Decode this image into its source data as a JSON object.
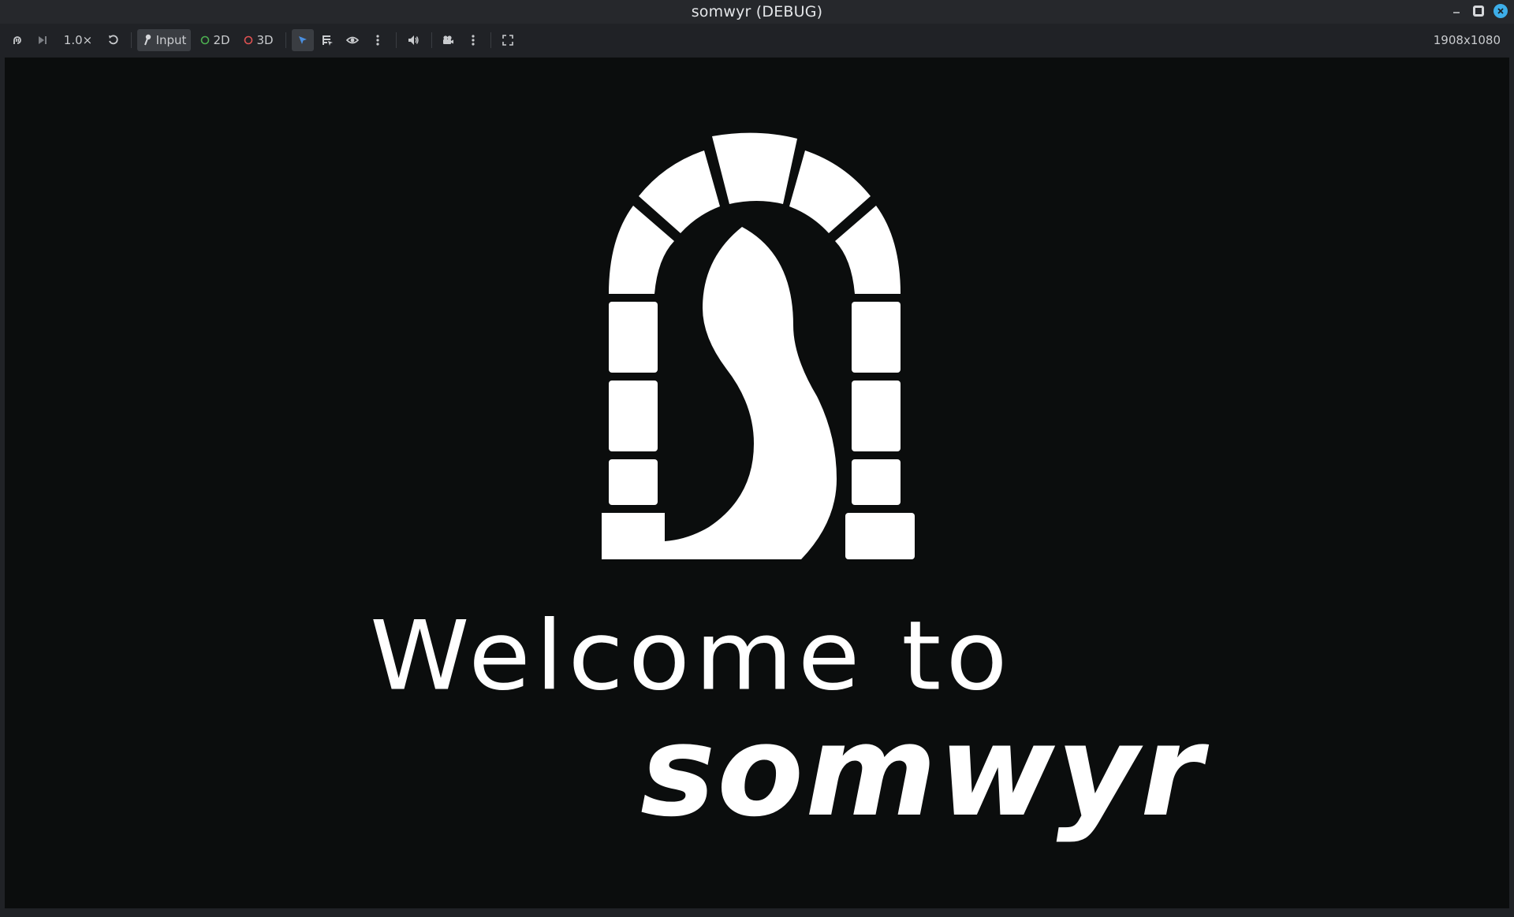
{
  "window": {
    "title": "somwyr (DEBUG)",
    "controls": [
      {
        "name": "minimize-icon"
      },
      {
        "name": "maximize-icon"
      },
      {
        "name": "close-icon"
      }
    ]
  },
  "toolbar": {
    "speed": "1.0×",
    "input_label": "Input",
    "mode_2d_label": "2D",
    "mode_3d_label": "3D",
    "resolution": "1908x1080"
  },
  "colors": {
    "accent_blue": "#3daee9",
    "mode_2d_ring": "#4caf50",
    "mode_3d_ring": "#e05252",
    "select_arrow": "#4a8fe0"
  },
  "viewport": {
    "welcome_text": "Welcome to",
    "brand_text": "somwyr"
  }
}
